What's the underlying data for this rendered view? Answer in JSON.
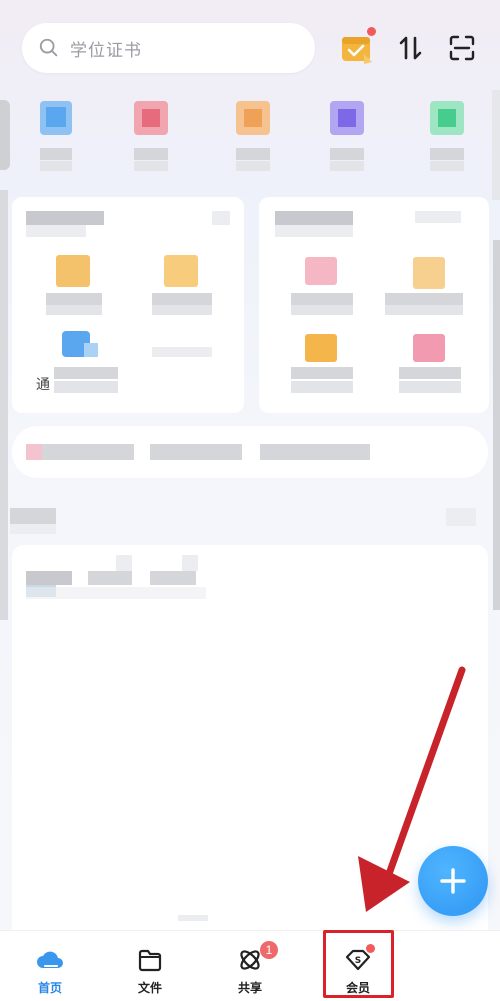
{
  "search": {
    "placeholder": "学位证书"
  },
  "top_icons": [
    "calendar-check-icon",
    "sort-icon",
    "scan-icon"
  ],
  "partial_text": "通",
  "bottom_nav": {
    "items": [
      {
        "label": "首页",
        "icon": "cloud-home-icon",
        "active": true
      },
      {
        "label": "文件",
        "icon": "folder-icon",
        "active": false
      },
      {
        "label": "共享",
        "icon": "share-orbit-icon",
        "active": false,
        "badge": "1"
      },
      {
        "label": "会员",
        "icon": "vip-diamond-icon",
        "active": false
      }
    ]
  },
  "colors": {
    "accent": "#2a86e6",
    "highlight": "#d8232a",
    "fab": "#3aa2f6",
    "badge": "#ee6a6a"
  }
}
